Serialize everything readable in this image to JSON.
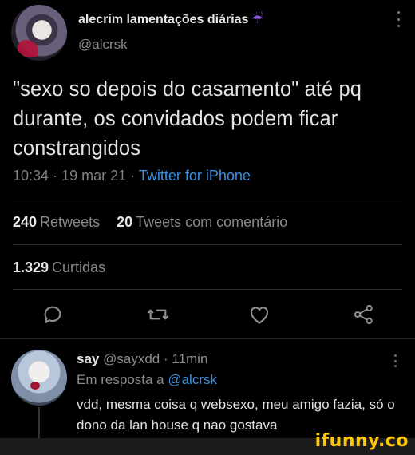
{
  "tweet": {
    "display_name": "alecrim lamentações diárias",
    "name_emoji": "☔",
    "handle": "@alcrsk",
    "text": "\"sexo so depois do casamento\" até pq durante, os convidados podem ficar constrangidos",
    "time": "10:34",
    "date": "19 mar 21",
    "separator": "·",
    "source": "Twitter for iPhone",
    "retweets_count": "240",
    "retweets_label": "Retweets",
    "quotes_count": "20",
    "quotes_label": "Tweets com comentário",
    "likes_count": "1.329",
    "likes_label": "Curtidas"
  },
  "actions": {
    "icons": [
      "reply-icon",
      "retweet-icon",
      "like-icon",
      "share-icon"
    ]
  },
  "reply": {
    "display_name": "say",
    "handle": "@sayxdd",
    "separator": "·",
    "time_ago": "11min",
    "replying_to_label": "Em resposta a",
    "replying_to_handle": "@alcrsk",
    "text": "vdd,  mesma coisa q websexo, meu amigo fazia, só o dono da lan house q nao gostava"
  },
  "watermark": {
    "text": "ifunny.co"
  },
  "colors": {
    "background": "#000000",
    "link": "#3c8fe0",
    "watermark": "#ffc800",
    "muted_text": "#8b8b8b"
  }
}
